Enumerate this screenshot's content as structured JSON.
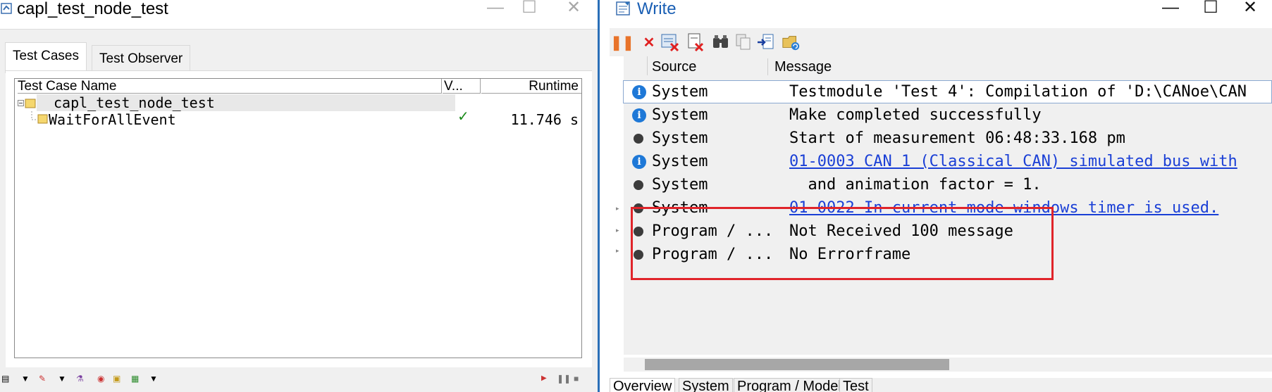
{
  "left_window": {
    "title": "capl_test_node_test",
    "controls": {
      "minimize": "—",
      "maximize": "☐",
      "close": "✕"
    },
    "tabs": [
      "Test Cases",
      "Test Observer"
    ],
    "columns": {
      "name": "Test Case Name",
      "verdict": "V...",
      "runtime": "Runtime"
    },
    "tree": {
      "root": "capl_test_node_test",
      "child": {
        "name": "WaitForAllEvent",
        "verdict": "✓",
        "runtime": "11.746 s"
      }
    }
  },
  "write_window": {
    "title": "Write",
    "controls": {
      "minimize": "—",
      "maximize": "☐",
      "close": "✕"
    },
    "columns": {
      "source": "Source",
      "message": "Message"
    },
    "rows": [
      {
        "icon": "info",
        "source": "System",
        "message": "Testmodule 'Test 4': Compilation of 'D:\\CANoe\\CAN",
        "link": false
      },
      {
        "icon": "info",
        "source": "System",
        "message": "Make completed successfully",
        "link": false
      },
      {
        "icon": "dot",
        "source": "System",
        "message": "Start of measurement 06:48:33.168 pm",
        "link": false
      },
      {
        "icon": "info",
        "source": "System",
        "message": "01-0003 CAN 1 (Classical CAN)  simulated bus with",
        "link": true
      },
      {
        "icon": "dot",
        "source": "System",
        "message": "  and animation factor = 1.",
        "link": false
      },
      {
        "icon": "dot",
        "source": "System",
        "message": "01-0022 In current mode windows timer is used.",
        "link": true
      },
      {
        "icon": "dot",
        "source": "Program / ...",
        "message": "Not Received 100 message",
        "link": false
      },
      {
        "icon": "dot",
        "source": "Program / ...",
        "message": "No Errorframe",
        "link": false
      }
    ],
    "bottom_tabs": [
      "Overview",
      "System",
      "Program / Model",
      "Test"
    ],
    "highlight_color": "#e0242a"
  }
}
